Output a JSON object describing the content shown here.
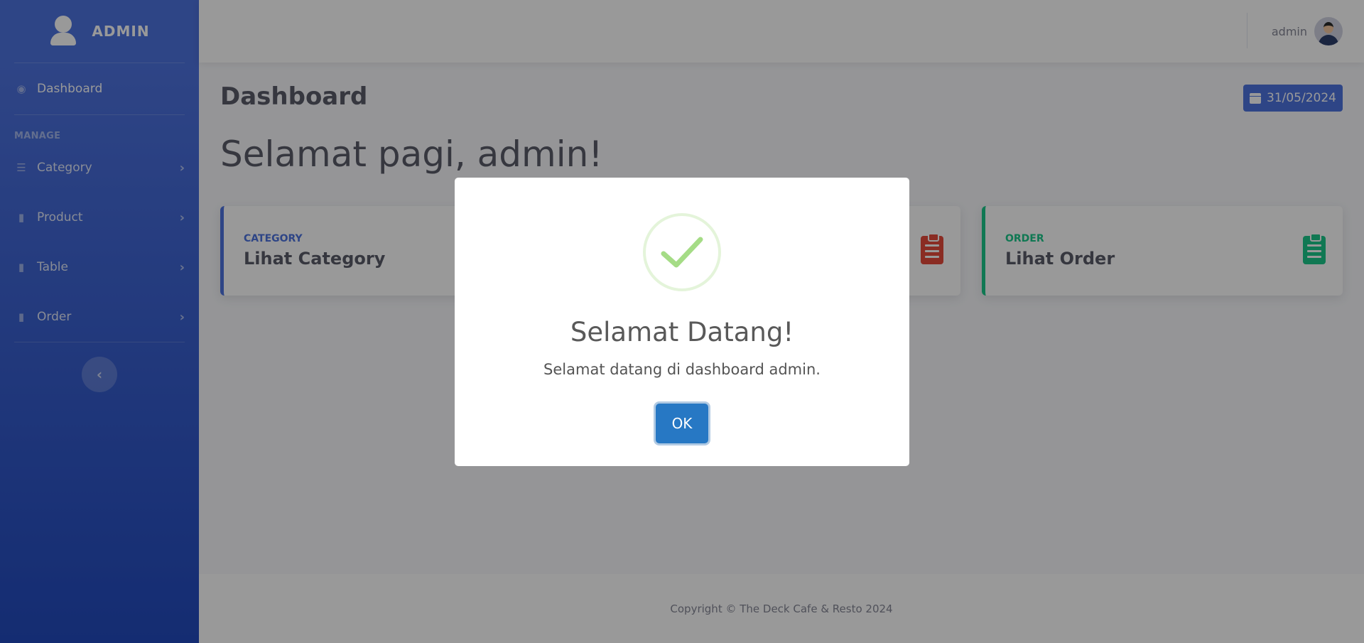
{
  "sidebar": {
    "brand": "ADMIN",
    "items": [
      {
        "label": "Dashboard",
        "icon": "tachometer-icon"
      },
      {
        "label": "Category",
        "icon": "list-icon"
      },
      {
        "label": "Product",
        "icon": "book-icon"
      },
      {
        "label": "Table",
        "icon": "book-icon"
      },
      {
        "label": "Order",
        "icon": "book-icon"
      }
    ],
    "heading": "MANAGE",
    "chevron": "›",
    "toggle": "‹"
  },
  "topbar": {
    "username": "admin"
  },
  "main": {
    "title": "Dashboard",
    "date": "31/05/2024",
    "greeting": "Selamat pagi, admin!",
    "cards": [
      {
        "label": "CATEGORY",
        "title": "Lihat Category",
        "color": "#4e73df"
      },
      {
        "label": "",
        "title": "",
        "color": "#e74a3b"
      },
      {
        "label": "ORDER",
        "title": "Lihat Order",
        "color": "#1cc88a"
      }
    ]
  },
  "footer": {
    "text": "Copyright © The Deck Cafe & Resto 2024"
  },
  "modal": {
    "title": "Selamat Datang!",
    "text": "Selamat datang di dashboard admin.",
    "button": "OK",
    "icon": "success-check-icon"
  },
  "colors": {
    "primary": "#4e73df",
    "danger": "#e74a3b",
    "success": "#1cc88a",
    "confirm_button": "#2778c4"
  }
}
